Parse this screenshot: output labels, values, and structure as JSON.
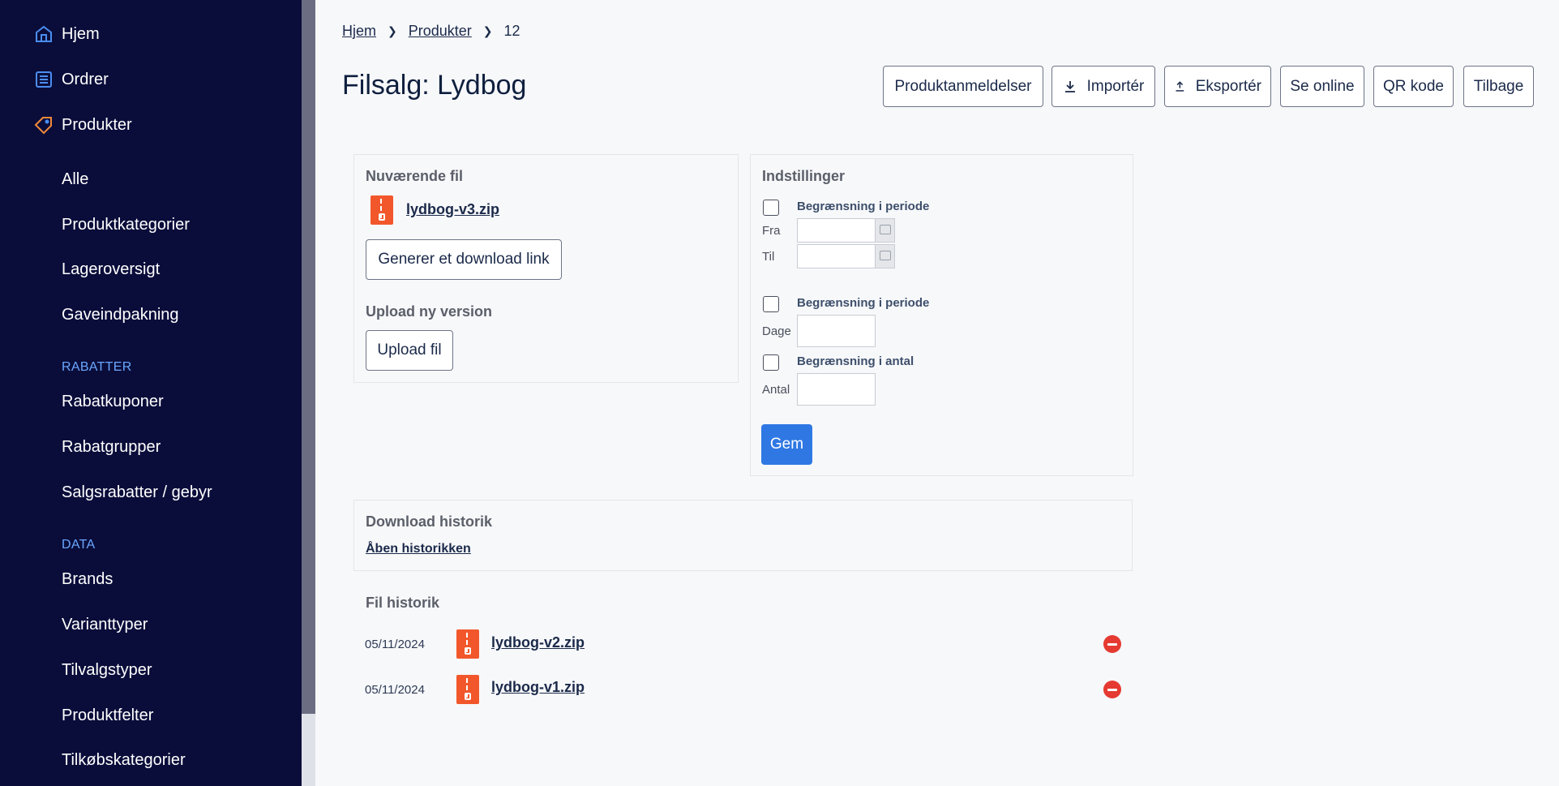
{
  "sidebar": {
    "top_items": [
      {
        "label": "Hjem",
        "icon": "home-icon"
      },
      {
        "label": "Ordrer",
        "icon": "orders-icon"
      },
      {
        "label": "Produkter",
        "icon": "tag-icon"
      }
    ],
    "product_items": [
      "Alle",
      "Produktkategorier",
      "Lageroversigt",
      "Gaveindpakning"
    ],
    "sections": {
      "rabatter": {
        "title": "RABATTER",
        "items": [
          "Rabatkuponer",
          "Rabatgrupper",
          "Salgsrabatter / gebyr"
        ]
      },
      "data": {
        "title": "DATA",
        "items": [
          "Brands",
          "Varianttyper",
          "Tilvalgstyper",
          "Produktfelter",
          "Tilkøbskategorier"
        ]
      }
    }
  },
  "breadcrumb": {
    "home": "Hjem",
    "products": "Produkter",
    "current": "12"
  },
  "page": {
    "title": "Filsalg: Lydbog"
  },
  "toolbar": {
    "reviews": "Produktanmeldelser",
    "import": "Importér",
    "export": "Eksportér",
    "view_online": "Se online",
    "qr": "QR kode",
    "back": "Tilbage"
  },
  "current_file": {
    "title": "Nuværende fil",
    "filename": "lydbog-v3.zip",
    "generate_link": "Generer et download link",
    "upload_title": "Upload ny version",
    "upload_button": "Upload fil"
  },
  "settings": {
    "title": "Indstillinger",
    "period_limit_label": "Begrænsning i periode",
    "from_label": "Fra",
    "to_label": "Til",
    "days_limit_label": "Begrænsning i periode",
    "days_label": "Dage",
    "count_limit_label": "Begrænsning i antal",
    "count_label": "Antal",
    "save": "Gem"
  },
  "download_history": {
    "title": "Download historik",
    "link": "Åben historikken"
  },
  "file_history": {
    "title": "Fil historik",
    "rows": [
      {
        "date": "05/11/2024",
        "filename": "lydbog-v2.zip"
      },
      {
        "date": "05/11/2024",
        "filename": "lydbog-v1.zip"
      }
    ]
  },
  "colors": {
    "sidebar_bg": "#0a0d3a",
    "accent_blue": "#2f78e4",
    "section_title": "#6aa7ff",
    "zip_orange": "#f2572b",
    "remove_red": "#e53a31",
    "arrow_orange": "#f5a030"
  }
}
